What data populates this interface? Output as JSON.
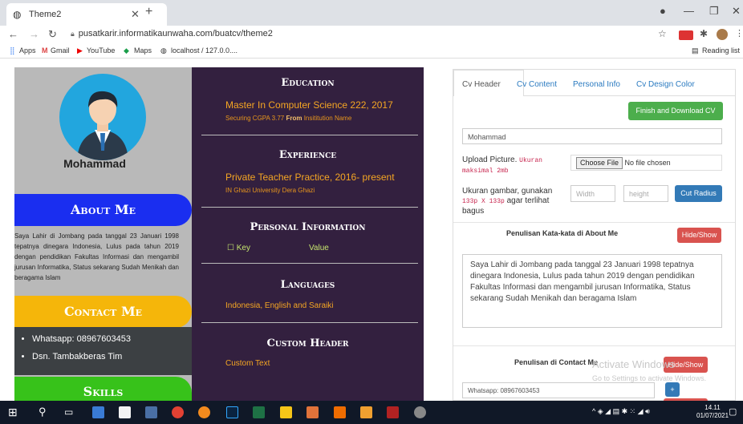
{
  "browser": {
    "tab_title": "Theme2",
    "url": "pusatkarir.informatikaunwaha.com/buatcv/theme2",
    "bookmarks": [
      "Apps",
      "Gmail",
      "YouTube",
      "Maps",
      "localhost / 127.0.0...."
    ],
    "reading_list": "Reading list"
  },
  "cv": {
    "name": "Mohammad",
    "about_title": "About Me",
    "about_text": "Saya Lahir di Jombang pada tanggal 23 Januari 1998 tepatnya dinegara Indonesia, Lulus pada tahun 2019 dengan pendidikan Fakultas Informasi dan mengambil jurusan Informatika, Status sekarang Sudah Menikah dan beragama Islam",
    "contact_title": "Contact Me",
    "contacts": [
      "Whatsapp: 08967603453",
      "Dsn. Tambakberas Tim"
    ],
    "skills_title": "Skills",
    "education_title": "Education",
    "education_degree": "Master In Computer Science 222, 2017",
    "education_detail_a": "Securing CGPA 3.77",
    "education_detail_from": "From",
    "education_detail_b": "Insititution Name",
    "experience_title": "Experience",
    "experience_role": "Private Teacher Practice, 2016- present",
    "experience_place": "IN Ghazi University Dera Ghazi",
    "personal_title": "Personal Information",
    "personal_key": "Key",
    "personal_value": "Value",
    "languages_title": "Languages",
    "languages_value": "Indonesia, English and Saraiki",
    "custom_title": "Custom Header",
    "custom_value": "Custom Text"
  },
  "form": {
    "tabs": [
      "Cv Header",
      "Cv Content",
      "Personal Info",
      "Cv Design Color"
    ],
    "finish_button": "Finish and Download CV",
    "name_value": "Mohammad",
    "upload_label": "Upload Picture.",
    "upload_hint": "Ukuran maksimal 2mb",
    "choose_file": "Choose File",
    "no_file": "No file chosen",
    "size_label_a": "Ukuran gambar, gunakan",
    "size_hint": "133p X 133p",
    "size_label_b": "agar terlihat bagus",
    "width_placeholder": "Width",
    "height_placeholder": "height",
    "cut_radius": "Cut Radius",
    "about_section": "Penulisan Kata-kata di About Me",
    "hide_show": "Hide/Show",
    "about_textarea": "Saya Lahir di Jombang pada tanggal 23 Januari 1998 tepatnya dinegara Indonesia, Lulus pada tahun 2019 dengan pendidikan Fakultas Informasi dan mengambil jurusan Informatika, Status sekarang Sudah Menikah dan beragama Islam",
    "contact_section": "Penulisan di Contact Me",
    "contact_input": "Whatsapp: 08967603453",
    "plus": "+"
  },
  "watermark": {
    "line1": "Activate Windows",
    "line2": "Go to Settings to activate Windows."
  },
  "taskbar": {
    "time": "14.11",
    "date": "01/07/2021"
  },
  "colors": {
    "about_pill": "#1a2ef0",
    "contact_pill": "#f5b60a",
    "skills_pill": "#37c21a",
    "mid_bg": "#33203f",
    "accent_gold": "#f5a623",
    "finish_btn": "#4cae4c",
    "danger_btn": "#d9534f",
    "primary_btn": "#337ab7"
  }
}
